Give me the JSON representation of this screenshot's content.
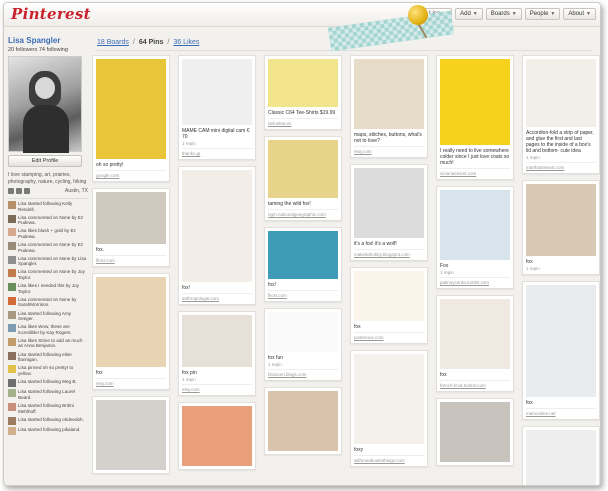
{
  "header": {
    "logo": "Pinterest",
    "nav": [
      {
        "label": "Lisa",
        "has_avatar": true
      },
      {
        "label": "Add"
      },
      {
        "label": "Boards"
      },
      {
        "label": "People"
      },
      {
        "label": "About"
      }
    ]
  },
  "profile": {
    "name": "Lisa Spangler",
    "stats": "20 followers  74 following",
    "edit_label": "Edit Profile",
    "bio": "I love stamping, art, prairies, photography, nature, cycling, hiking",
    "location": "Austin, TX"
  },
  "activity": [
    {
      "text": "Lisa started following Kelly Rendell.",
      "color": "#b8906c"
    },
    {
      "text": "Lisa commented on None by Ez Pudewa.",
      "color": "#7d6b5a"
    },
    {
      "text": "Lisa likes blush + gold by Ez Pudewa.",
      "color": "#d4a98e"
    },
    {
      "text": "Lisa commented on None by Ez Pudewa.",
      "color": "#9a8a7a"
    },
    {
      "text": "Lisa commented on None by Lisa Spangler.",
      "color": "#8f8f8f"
    },
    {
      "text": "Lisa commented on None by Joy Taylor.",
      "color": "#c27d4e"
    },
    {
      "text": "Lisa likes I needed this by Joy Taylor.",
      "color": "#6b8f5c"
    },
    {
      "text": "Lisa commented on None by SarahMorrison.",
      "color": "#d26a3a"
    },
    {
      "text": "Lisa started following Amy Seeger.",
      "color": "#a89a80"
    },
    {
      "text": "Lisa likes Wow, these are incredible! by Kay Rogers.",
      "color": "#7f9cb3"
    },
    {
      "text": "Lisa likes Strive to add as much as Anna Benjamin.",
      "color": "#c49c6a"
    },
    {
      "text": "Lisa started following elsie flannigan.",
      "color": "#8b6f5e"
    },
    {
      "text": "Lisa pinned oh so pretty! to yellow.",
      "color": "#e0c14a"
    },
    {
      "text": "Lisa started following Meg B.",
      "color": "#6f6f6f"
    },
    {
      "text": "Lisa started following Laurel Beard.",
      "color": "#a3b28a"
    },
    {
      "text": "Lisa started following Brittni Mehlhoff.",
      "color": "#c88f7a"
    },
    {
      "text": "Lisa started following ohdeedoh.",
      "color": "#9c7b63"
    },
    {
      "text": "Lisa started following pikaland.",
      "color": "#d0b08c"
    }
  ],
  "tabs": [
    {
      "label": "18 Boards",
      "active": false
    },
    {
      "label": "64 Pins",
      "active": true
    },
    {
      "label": "36 Likes",
      "active": false
    }
  ],
  "tab_separator": "/",
  "pins": [
    [
      {
        "caption": "oh so pretty!",
        "meta": "",
        "source": "google.com",
        "img": "#e9c53a"
      },
      {
        "caption": "fox.",
        "meta": "",
        "source": "flickr.com",
        "img": "#cfc9c0"
      },
      {
        "caption": "fox",
        "meta": "",
        "source": "etsy.com",
        "img": "#e8d3b3"
      },
      {
        "caption": "",
        "meta": "",
        "source": "",
        "img": "#d4d0cc"
      }
    ],
    [
      {
        "caption": "MAME CAM mini digital cam € 70",
        "meta": "1 repin",
        "source": "thanko.jp",
        "img": "#efefef"
      },
      {
        "caption": "fox!",
        "meta": "",
        "source": "anthropologie.com",
        "img": "#f2ede6"
      },
      {
        "caption": "fox pin",
        "meta": "1 repin",
        "source": "etsy.com",
        "img": "#e6e0d8"
      },
      {
        "caption": "",
        "meta": "",
        "source": "",
        "img": "#e9a07a"
      }
    ],
    [
      {
        "caption": "Classic C64 Tee-Shirts $19.99",
        "meta": "",
        "source": "defunkta.es",
        "img": "#f1e48a"
      },
      {
        "caption": "taming the wild fox!",
        "meta": "",
        "source": "ngm.nationalgeographic.com",
        "img": "#e7d48b"
      },
      {
        "caption": "fox!",
        "meta": "",
        "source": "flickr.com",
        "img": "#3f9bb7"
      },
      {
        "caption": "fox fun",
        "meta": "1 repin",
        "source": "blossom.blogs.com",
        "img": "#fafafa"
      },
      {
        "caption": "",
        "meta": "",
        "source": "",
        "img": "#d9c3ad"
      }
    ],
    [
      {
        "caption": "maps, stitches, buttons, what's not to love?",
        "meta": "",
        "source": "etsy.com",
        "img": "#e6dcc8"
      },
      {
        "caption": "it's a fox! it's a wolf!",
        "meta": "",
        "source": "makeitahobby.blogspot.com",
        "img": "#dcdcdc"
      },
      {
        "caption": "fox",
        "meta": "",
        "source": "posterous.com",
        "img": "#fbf4ea"
      },
      {
        "caption": "foxy",
        "meta": "",
        "source": "withmeaboutinthings.com",
        "img": "#f4f1ec"
      }
    ],
    [
      {
        "caption": "I really need to live somewhere colder since I just love coats so much!",
        "meta": "",
        "source": "victoriasecret.com",
        "img": "#f6d21d"
      },
      {
        "caption": "Fox",
        "meta": "1 repin",
        "source": "patinoycerda.tumblr.com",
        "img": "#d7e4ec"
      },
      {
        "caption": "fox",
        "meta": "",
        "source": "french-knot.tumblr.com",
        "img": "#efe9e2"
      },
      {
        "caption": "",
        "meta": "",
        "source": "",
        "img": "#c9c3bd"
      }
    ],
    [
      {
        "caption": "Accordion-fold a strip of paper, and glue the first and last pages to the inside of a box's lid and bottom- cute idea",
        "meta": "1 repin",
        "source": "marthastewart.com",
        "img": "#f2efe9"
      },
      {
        "caption": "fox",
        "meta": "1 repin",
        "source": "",
        "img": "#d8c9b4"
      },
      {
        "caption": "fox",
        "meta": "",
        "source": "mamonline.net",
        "img": "#e9ecef"
      },
      {
        "caption": "",
        "meta": "",
        "source": "",
        "img": "#eee"
      }
    ]
  ],
  "colors": {
    "logo": "#c8232c",
    "link": "#3b6cb7",
    "tape": "#9fd3cf",
    "pushpin": "#e3b215"
  }
}
